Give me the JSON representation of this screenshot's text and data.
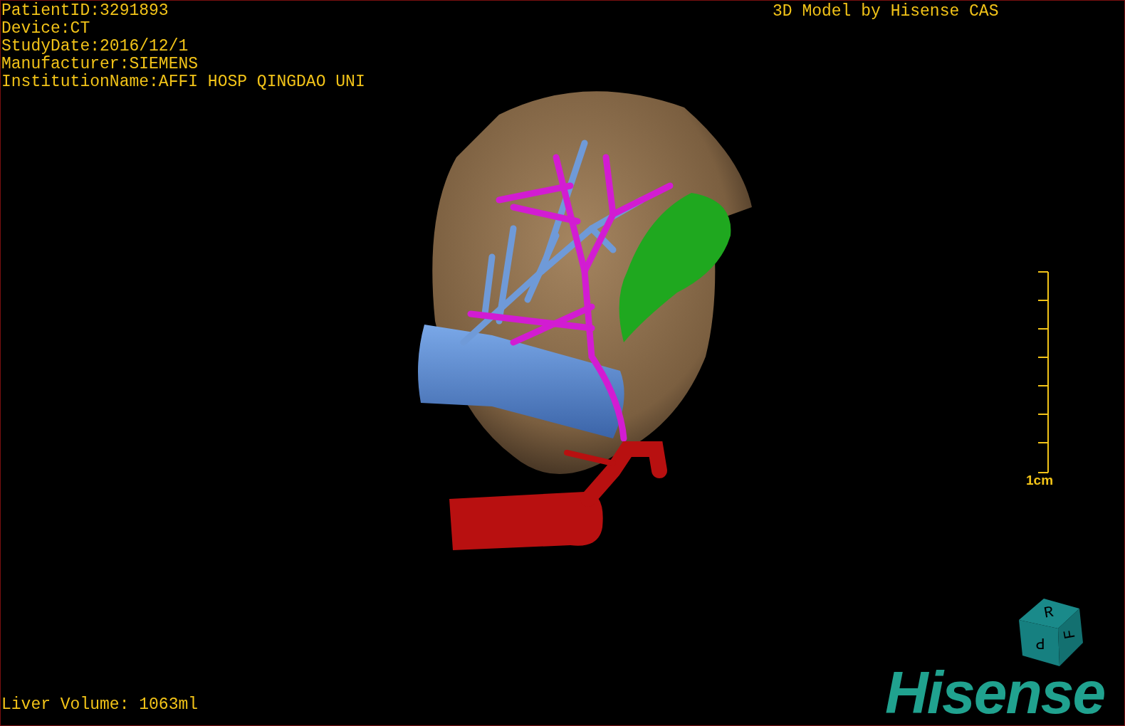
{
  "patient_info": [
    "PatientID:3291893",
    "Device:CT",
    "StudyDate:2016/12/1",
    "Manufacturer:SIEMENS",
    "InstitutionName:AFFI HOSP QINGDAO UNI"
  ],
  "title": "3D Model by Hisense CAS",
  "scale_bar": {
    "label": "1cm"
  },
  "orientation_cube": {
    "faces": [
      "R",
      "F",
      "P"
    ]
  },
  "logo": "Hisense",
  "liver_volume": "Liver Volume: 1063ml"
}
